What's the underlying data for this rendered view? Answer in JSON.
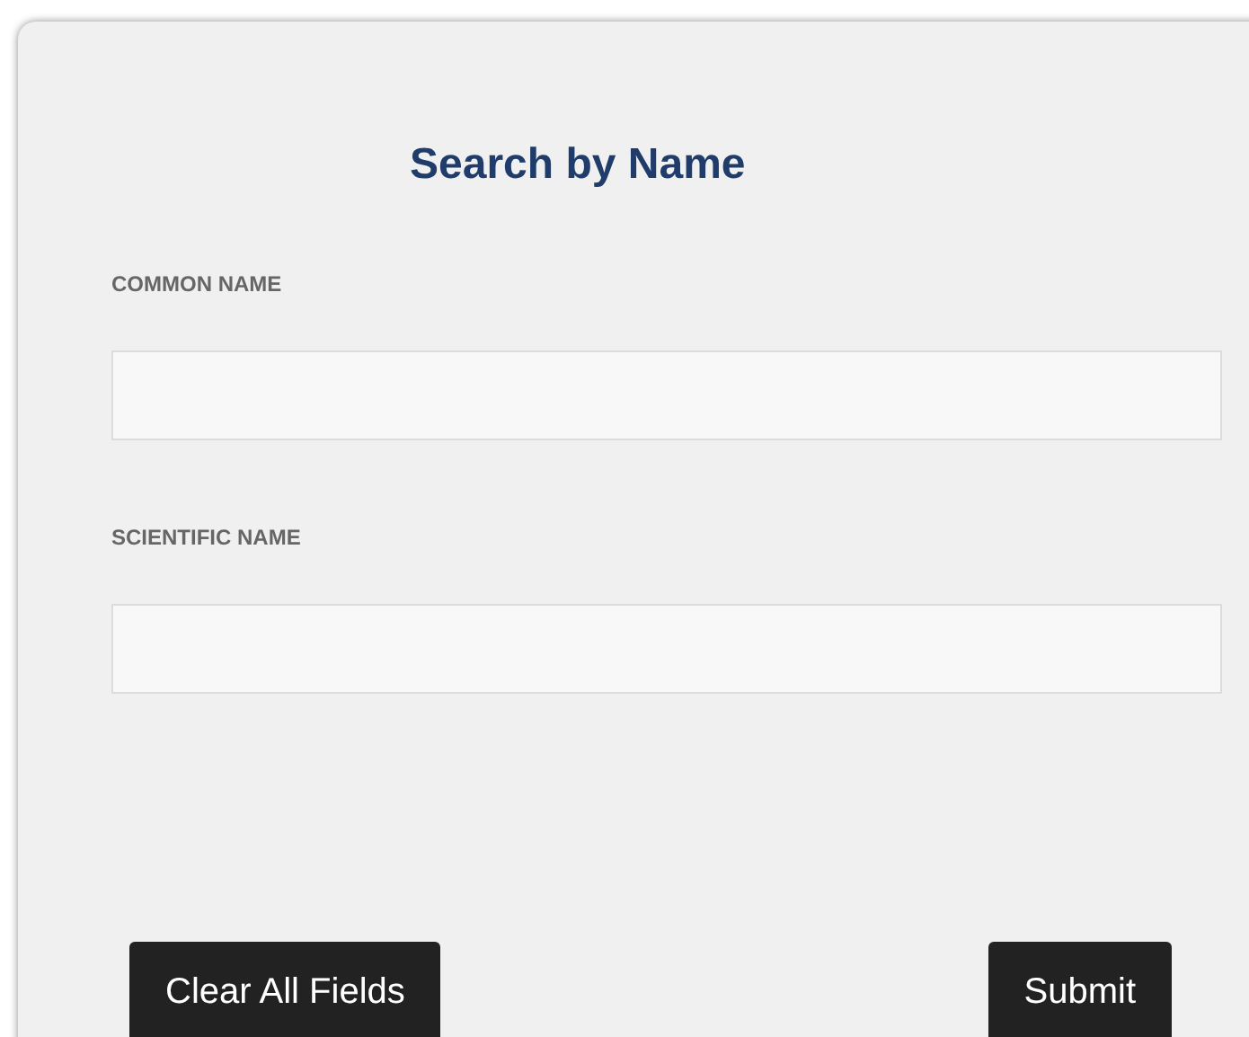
{
  "title": "Search by Name",
  "fields": [
    {
      "label": "COMMON NAME"
    },
    {
      "label": "SCIENTIFIC NAME"
    }
  ],
  "buttons": [
    {
      "label": "Clear All Fields"
    },
    {
      "label": "Submit"
    }
  ]
}
